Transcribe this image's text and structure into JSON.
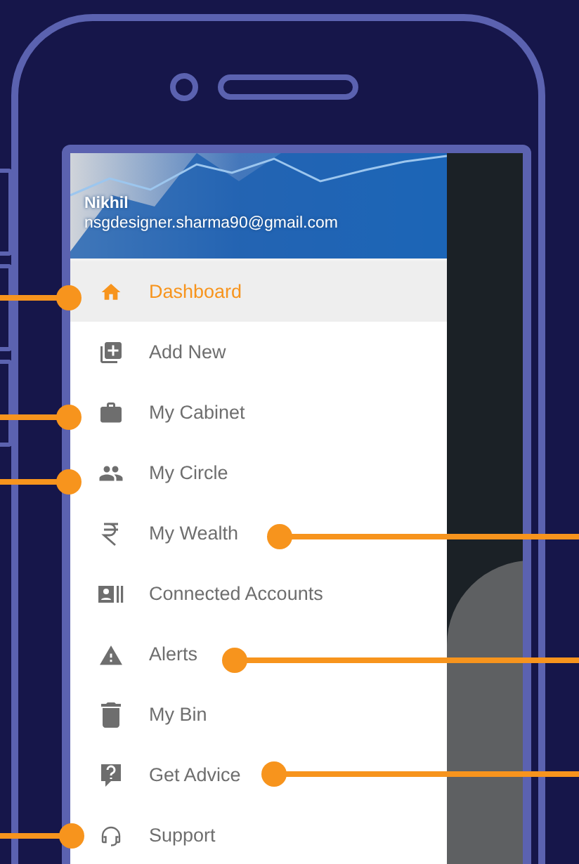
{
  "drawer_header": {
    "name": "Nikhil",
    "email": "nsgdesigner.sharma90@gmail.com"
  },
  "menu_items": [
    {
      "label": "Dashboard",
      "selected": true
    },
    {
      "label": "Add New",
      "selected": false
    },
    {
      "label": "My Cabinet",
      "selected": false
    },
    {
      "label": "My Circle",
      "selected": false
    },
    {
      "label": "My Wealth",
      "selected": false
    },
    {
      "label": "Connected Accounts",
      "selected": false
    },
    {
      "label": "Alerts",
      "selected": false
    },
    {
      "label": "My Bin",
      "selected": false
    },
    {
      "label": "Get Advice",
      "selected": false
    },
    {
      "label": "Support",
      "selected": false
    }
  ]
}
